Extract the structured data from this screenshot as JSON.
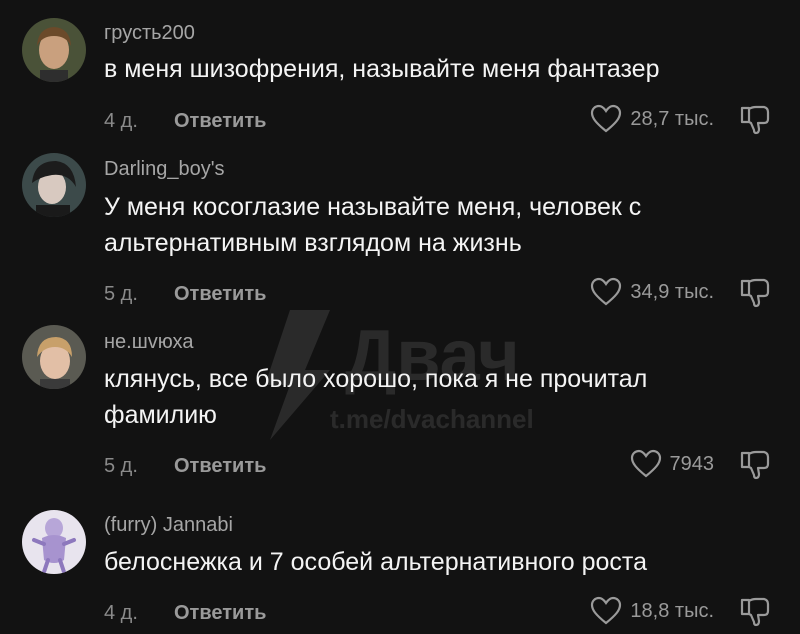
{
  "comments": [
    {
      "username": "грусть200",
      "lines": [
        "в меня шизофрения, называйте меня фантазер"
      ],
      "time": "4 д.",
      "reply_label": "Ответить",
      "likes": "28,7 тыс."
    },
    {
      "username": "Darling_boy's",
      "lines": [
        "У меня косоглазие называйте меня, человек с",
        "альтернативным взглядом на жизнь"
      ],
      "time": "5 д.",
      "reply_label": "Ответить",
      "likes": "34,9 тыс."
    },
    {
      "username": "не.шvюха",
      "lines": [
        "клянусь, все было хорошо, пока я не прочитал",
        "фамилию"
      ],
      "time": "5 д.",
      "reply_label": "Ответить",
      "likes": "7943"
    },
    {
      "username": "(furry) Jannabi",
      "lines": [
        "белоснежка и 7 особей альтернативного роста"
      ],
      "time": "4 д.",
      "reply_label": "Ответить",
      "likes": "18,8 тыс."
    }
  ],
  "watermark": {
    "brand": "Двач",
    "url": "t.me/dvachannel"
  },
  "icons": {
    "like": "heart-outline-icon",
    "dislike": "thumbs-down-outline-icon"
  },
  "colors": {
    "background": "#121212",
    "text": "#f4f4f4",
    "muted": "#9a9a9a"
  }
}
